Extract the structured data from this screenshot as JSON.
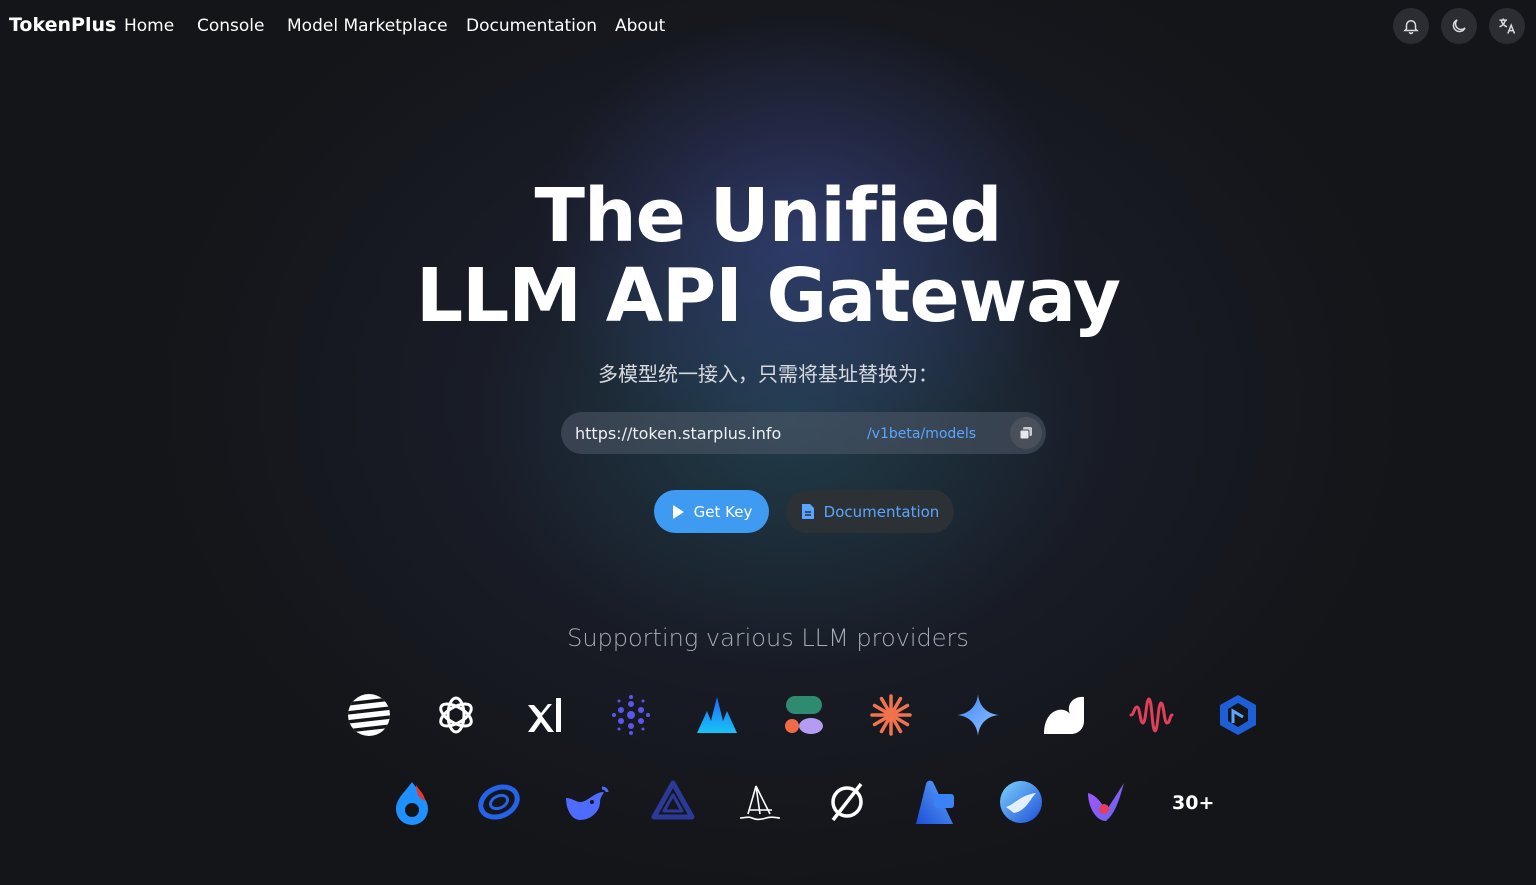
{
  "nav": {
    "brand": "TokenPlus",
    "links": [
      "Home",
      "Console",
      "Model Marketplace",
      "Documentation",
      "About"
    ],
    "icons": [
      "bell-icon",
      "moon-icon",
      "translate-icon"
    ]
  },
  "hero": {
    "title_line1": "The Unified",
    "title_line2": "LLM API Gateway",
    "subtitle": "多模型统一接入，只需将基址替换为：",
    "base_url": "https://token.starplus.info",
    "endpoint": "/v1beta/models",
    "get_key_label": "Get Key",
    "docs_label": "Documentation"
  },
  "providers": {
    "title": "Supporting various LLM providers",
    "row1": [
      "striped-sphere-logo",
      "openai-logo",
      "xai-logo",
      "dot-cluster-logo",
      "blue-peaks-logo",
      "shape-blocks-logo",
      "starburst-logo",
      "gemini-sparkle-logo",
      "wave-s-logo",
      "soundwave-logo",
      "blue-cube-logo"
    ],
    "row2": [
      "flame-drop-logo",
      "blue-ring-logo",
      "deepseek-whale-logo",
      "triangle-knot-logo",
      "sailboat-logo",
      "slashed-circle-logo",
      "blue-a-logo",
      "blue-orb-logo",
      "purple-comet-logo"
    ],
    "more": "30+"
  },
  "colors": {
    "accent": "#3f9bf2",
    "link": "#5aa6ff",
    "background": "#141518"
  }
}
